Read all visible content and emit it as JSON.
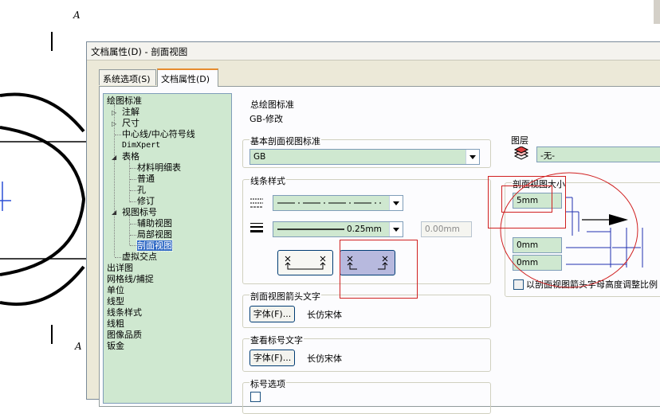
{
  "dialog": {
    "title": "文档属性(D) - 剖面视图",
    "tabs": [
      {
        "label": "系统选项(S)",
        "active": false
      },
      {
        "label": "文档属性(D)",
        "active": true
      }
    ]
  },
  "tree": {
    "items": [
      {
        "label": "绘图标准"
      },
      {
        "label": "注解"
      },
      {
        "label": "尺寸"
      },
      {
        "label": "中心线/中心符号线"
      },
      {
        "label": "DimXpert"
      },
      {
        "label": "表格"
      },
      {
        "label": "材料明细表"
      },
      {
        "label": "普通"
      },
      {
        "label": "孔"
      },
      {
        "label": "修订"
      },
      {
        "label": "视图标号"
      },
      {
        "label": "辅助视图"
      },
      {
        "label": "局部视图"
      },
      {
        "label": "剖面视图",
        "selected": true
      },
      {
        "label": "虚拟交点"
      },
      {
        "label": "出详图"
      },
      {
        "label": "网格线/捕捉"
      },
      {
        "label": "单位"
      },
      {
        "label": "线型"
      },
      {
        "label": "线条样式"
      },
      {
        "label": "线粗"
      },
      {
        "label": "图像品质"
      },
      {
        "label": "钣金"
      }
    ]
  },
  "overall_standard": {
    "label": "总绘图标准",
    "value": "GB-修改"
  },
  "base_standard": {
    "label": "基本剖面视图标准",
    "value": "GB"
  },
  "line_style": {
    "label": "线条样式",
    "thickness_value": "0.25mm",
    "custom_value": "0.00mm"
  },
  "layer": {
    "label": "图层",
    "value": "-无-"
  },
  "section_size": {
    "label": "剖面视图大小",
    "field1": "5mm",
    "field2": "0mm",
    "field3": "0mm",
    "checkbox_label": "以剖面视图箭头字母高度调整比例"
  },
  "arrow_text": {
    "label": "剖面视图箭头文字",
    "button": "字体(F)...",
    "font": "长仿宋体"
  },
  "label_text": {
    "label": "查看标号文字",
    "button": "字体(F)...",
    "font": "长仿宋体"
  },
  "label_options": {
    "label": "标号选项"
  },
  "background_letters": {
    "a1": "A",
    "a2": "A"
  },
  "colors": {
    "tree_bg": "#cfe8d0",
    "selection": "#316ac5",
    "annotation_red": "#d02020"
  }
}
